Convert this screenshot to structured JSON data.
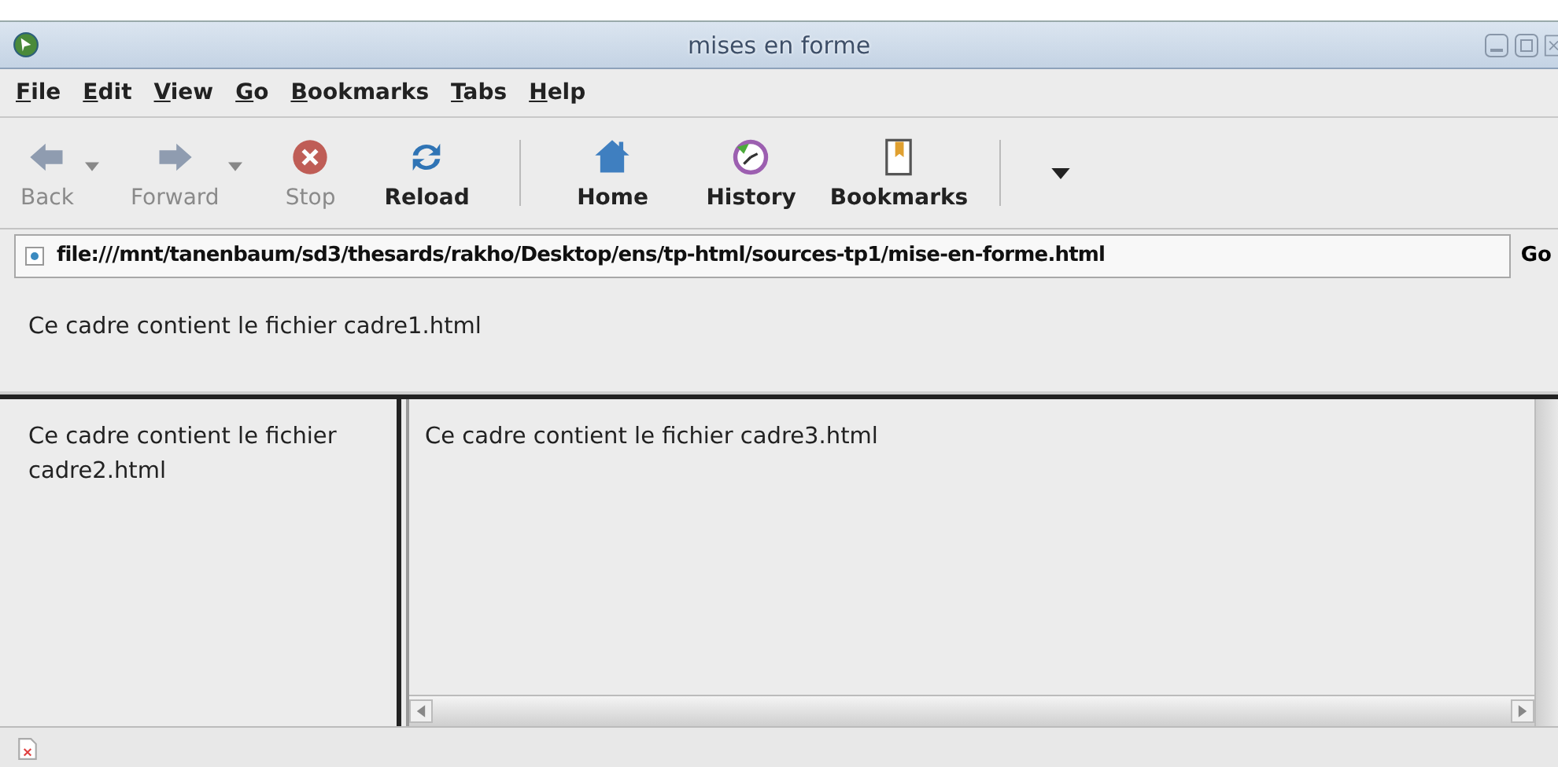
{
  "window": {
    "title": "mises en forme"
  },
  "menu": [
    {
      "label": "File"
    },
    {
      "label": "Edit"
    },
    {
      "label": "View"
    },
    {
      "label": "Go"
    },
    {
      "label": "Bookmarks"
    },
    {
      "label": "Tabs"
    },
    {
      "label": "Help"
    }
  ],
  "toolbar": [
    {
      "kind": "back",
      "label": "Back",
      "disabled": true
    },
    {
      "kind": "forward",
      "label": "Forward",
      "disabled": true
    },
    {
      "kind": "stop",
      "label": "Stop",
      "disabled": true
    },
    {
      "kind": "reload",
      "label": "Reload",
      "disabled": false
    },
    {
      "kind": "separator"
    },
    {
      "kind": "home",
      "label": "Home",
      "disabled": false
    },
    {
      "kind": "history",
      "label": "History",
      "disabled": false
    },
    {
      "kind": "bookmarks",
      "label": "Bookmarks",
      "disabled": false
    },
    {
      "kind": "separator"
    },
    {
      "kind": "overflow"
    }
  ],
  "address": {
    "value": "file:///mnt/tanenbaum/sd3/thesards/rakho/Desktop/ens/tp-html/sources-tp1/mise-en-forme.html",
    "go": "Go"
  },
  "frames": {
    "top": "Ce cadre contient le fichier cadre1.html",
    "left": "Ce cadre contient le fichier cadre2.html",
    "main": "Ce cadre contient le fichier cadre3.html"
  }
}
